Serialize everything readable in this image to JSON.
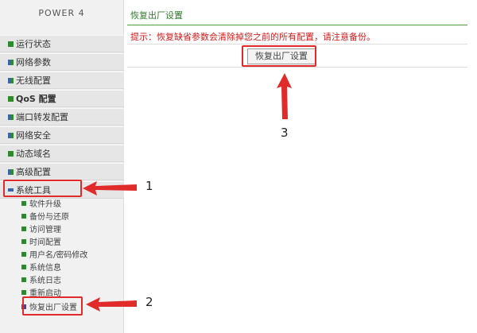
{
  "sidebar": {
    "brand": "POWER 4",
    "items": [
      {
        "label": "运行状态"
      },
      {
        "label": "网络参数"
      },
      {
        "label": "无线配置"
      },
      {
        "label": "QoS 配置"
      },
      {
        "label": "端口转发配置"
      },
      {
        "label": "网络安全"
      },
      {
        "label": "动态域名"
      },
      {
        "label": "高级配置"
      },
      {
        "label": "系统工具"
      }
    ],
    "sub_items": [
      {
        "label": "软件升级"
      },
      {
        "label": "备份与还原"
      },
      {
        "label": "访问管理"
      },
      {
        "label": "时间配置"
      },
      {
        "label": "用户名/密码修改"
      },
      {
        "label": "系统信息"
      },
      {
        "label": "系统日志"
      },
      {
        "label": "重新启动"
      },
      {
        "label": "恢复出厂设置"
      }
    ]
  },
  "main": {
    "title": "恢复出厂设置",
    "notice": "提示：恢复缺省参数会清除掉您之前的所有配置，请注意备份。",
    "restore_button": "恢复出厂设置"
  },
  "annotations": {
    "step1": "1",
    "step2": "2",
    "step3": "3",
    "highlight_color": "#e12a2a"
  }
}
